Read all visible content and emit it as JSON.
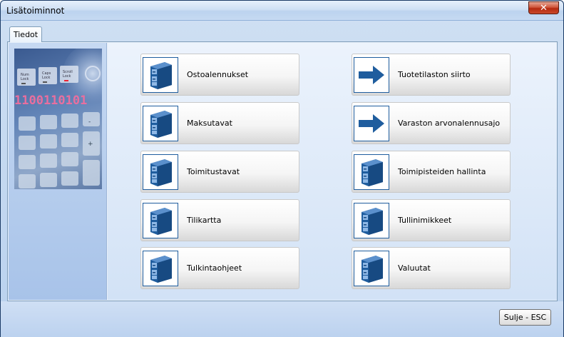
{
  "window": {
    "title": "Lisätoiminnot",
    "close_glyph": "✕"
  },
  "tabs": [
    {
      "label": "Tiedot",
      "active": true
    }
  ],
  "image": {
    "keys": [
      "Num Lock",
      "Caps Lock",
      "Scroll Lock"
    ],
    "binary": "1100110101"
  },
  "buttons": {
    "left": [
      {
        "label": "Ostoalennukset",
        "icon": "cabinet-icon"
      },
      {
        "label": "Maksutavat",
        "icon": "cabinet-icon"
      },
      {
        "label": "Toimitustavat",
        "icon": "cabinet-icon"
      },
      {
        "label": "Tilikartta",
        "icon": "cabinet-icon"
      },
      {
        "label": "Tulkintaohjeet",
        "icon": "cabinet-icon"
      }
    ],
    "right": [
      {
        "label": "Tuotetilaston siirto",
        "icon": "arrow-right-icon"
      },
      {
        "label": "Varaston arvonalennusajo",
        "icon": "arrow-right-icon"
      },
      {
        "label": "Toimipisteiden hallinta",
        "icon": "cabinet-icon"
      },
      {
        "label": "Tullinimikkeet",
        "icon": "cabinet-icon"
      },
      {
        "label": "Valuutat",
        "icon": "cabinet-icon"
      }
    ]
  },
  "footer": {
    "close_label": "Sulje - ESC"
  },
  "colors": {
    "icon_blue": "#1f5d9e",
    "accent_pink": "#e75a8c"
  }
}
